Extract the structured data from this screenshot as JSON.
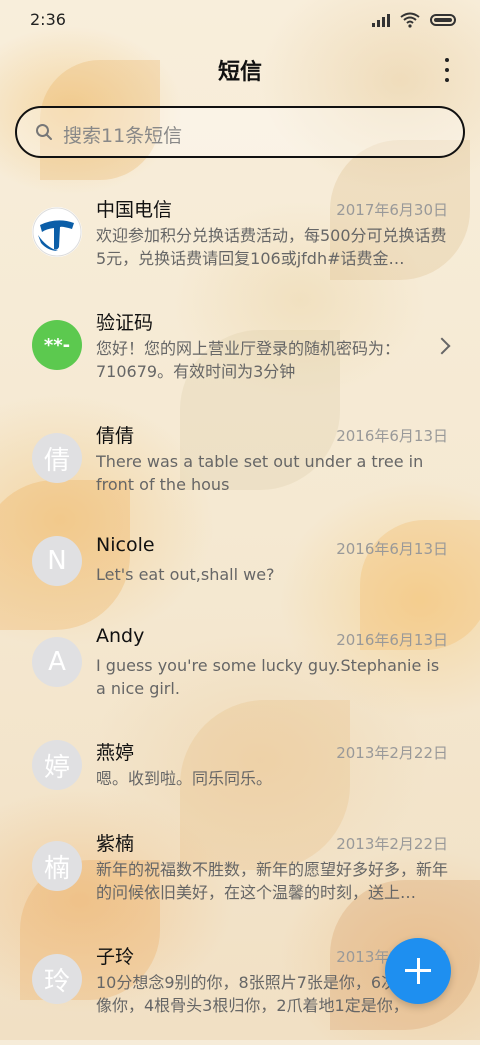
{
  "status_bar": {
    "time": "2:36"
  },
  "header": {
    "title": "短信"
  },
  "search": {
    "placeholder": "搜索11条短信"
  },
  "conversations": [
    {
      "name": "中国电信",
      "date": "2017年6月30日",
      "preview": "欢迎参加积分兑换话费活动，每500分可兑换话费5元，兑换话费请回复106或jfdh#话费金…",
      "avatar_text": "",
      "avatar_icon": "china-telecom-logo",
      "avatar_color": "#ffffff"
    },
    {
      "name": "验证码",
      "date": "",
      "preview": "您好！您的网上营业厅登录的随机密码为：710679。有效时间为3分钟",
      "avatar_text": "**-",
      "avatar_color": "#5cc94f"
    },
    {
      "name": "倩倩",
      "date": "2016年6月13日",
      "preview": "There was a table set out under a tree in front of the hous",
      "avatar_text": "倩",
      "avatar_color": "#e0e0e2"
    },
    {
      "name": "Nicole",
      "date": "2016年6月13日",
      "preview": "Let's eat out,shall we?",
      "avatar_text": "N",
      "avatar_color": "#e0e0e2"
    },
    {
      "name": "Andy",
      "date": "2016年6月13日",
      "preview": "I guess you're some lucky guy.Stephanie is a nice girl.",
      "avatar_text": "A",
      "avatar_color": "#e0e0e2"
    },
    {
      "name": "燕婷",
      "date": "2013年2月22日",
      "preview": "嗯。收到啦。同乐同乐。",
      "avatar_text": "婷",
      "avatar_color": "#e0e0e2"
    },
    {
      "name": "紫楠",
      "date": "2013年2月22日",
      "preview": "新年的祝福数不胜数，新年的愿望好多好多，新年的问候依旧美好，在这个温馨的时刻，送上…",
      "avatar_text": "楠",
      "avatar_color": "#e0e0e2"
    },
    {
      "name": "子玲",
      "date": "2013年2月22日",
      "preview": "10分想念9别的你，8张照片7张是你，6次梦里只像你，4根骨头3根归你，2爪着地1定是你，",
      "avatar_text": "玲",
      "avatar_color": "#e0e0e2"
    }
  ],
  "fab": {
    "icon": "plus-icon",
    "color": "#1e8ff0"
  }
}
